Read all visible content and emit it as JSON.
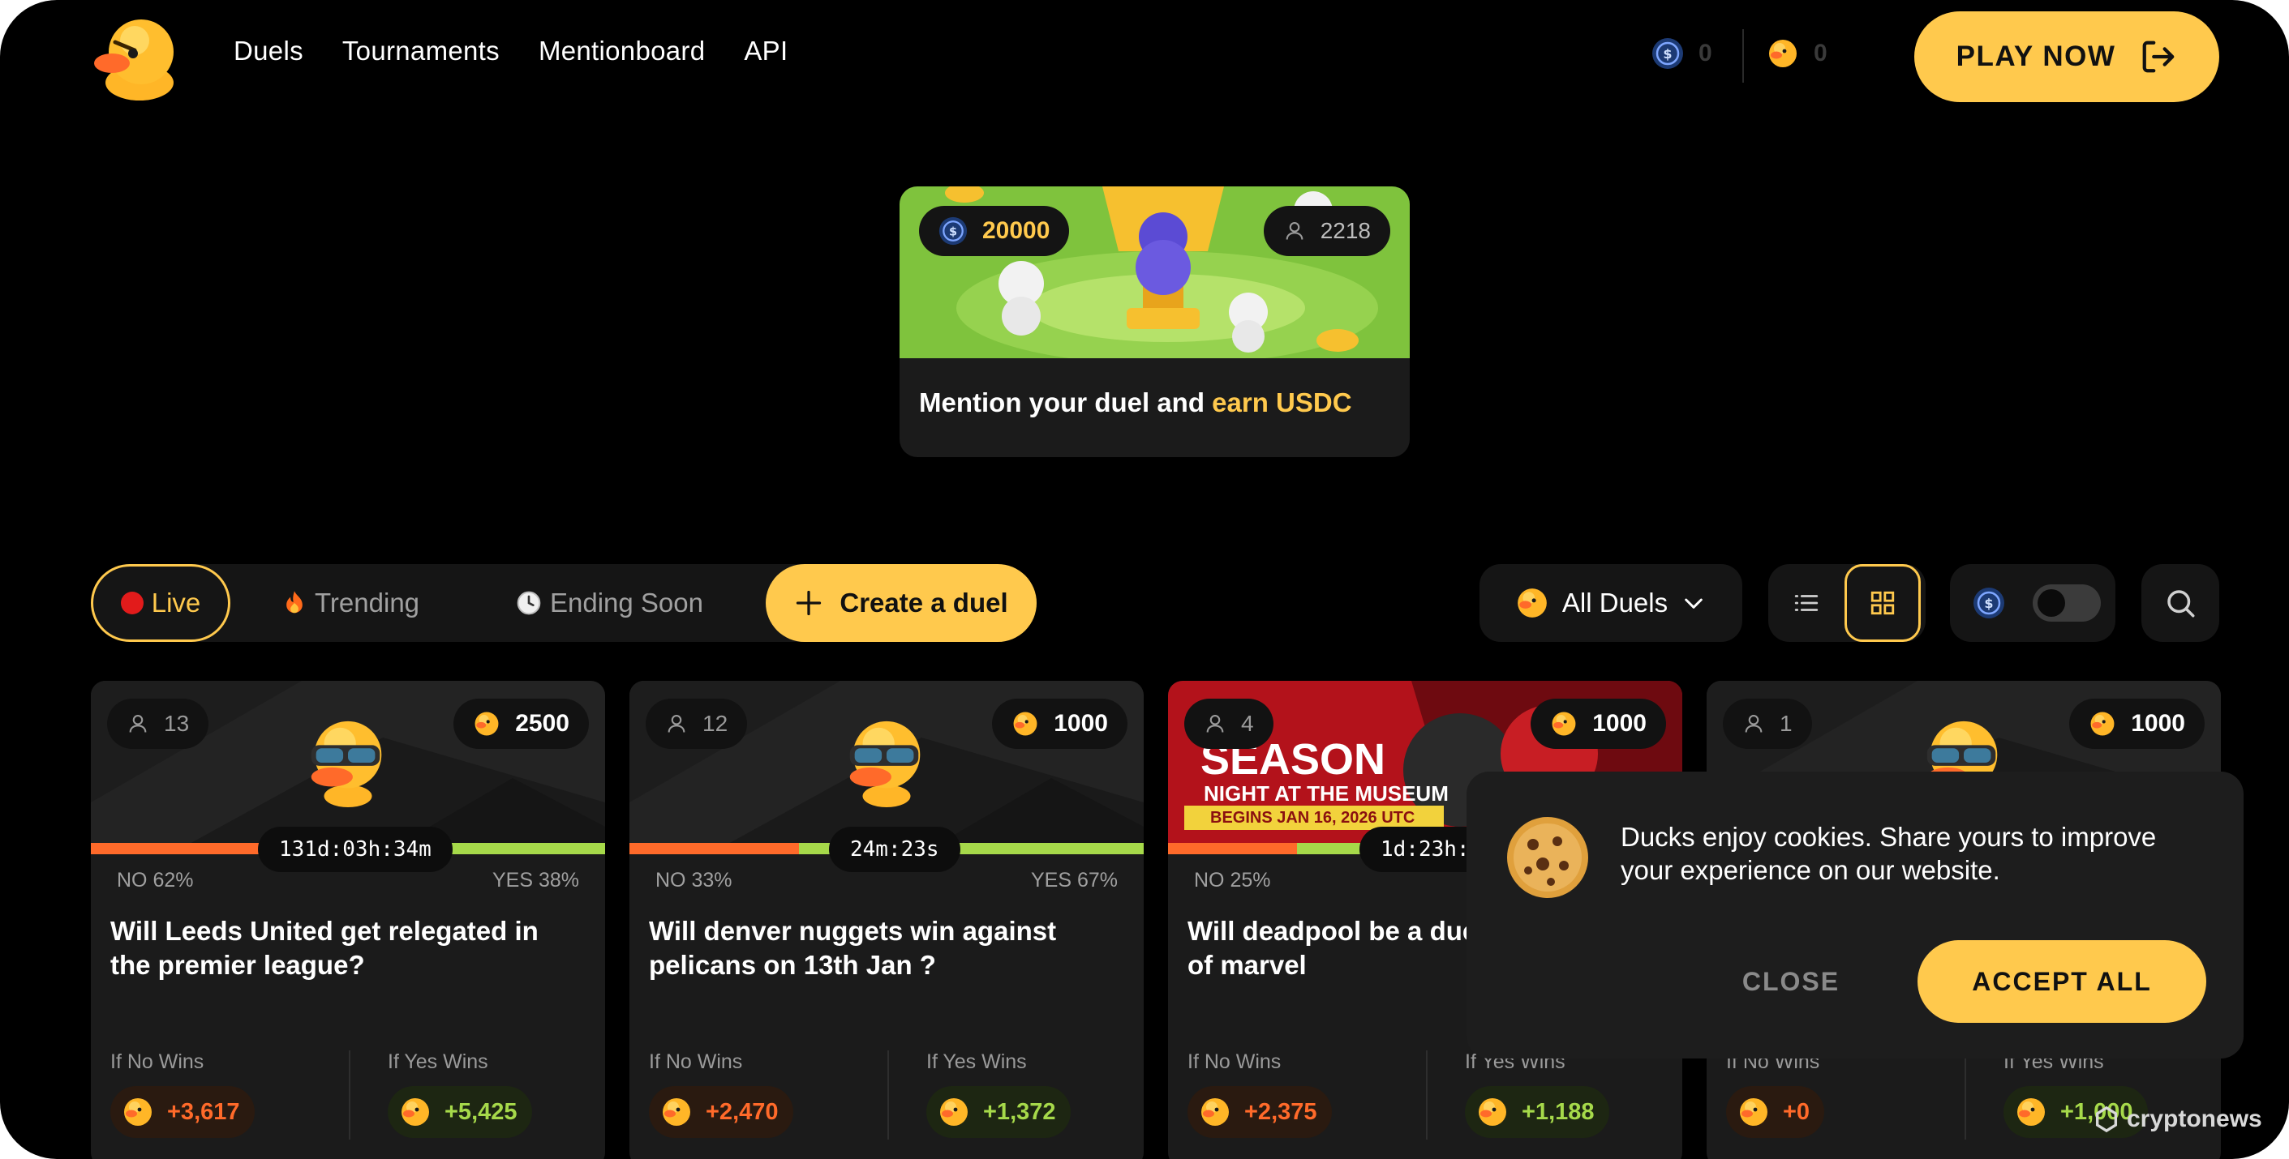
{
  "header": {
    "nav": [
      "Duels",
      "Tournaments",
      "Mentionboard",
      "API"
    ],
    "usdc_balance": "0",
    "duck_balance": "0",
    "play_label": "PLAY NOW",
    "colors": {
      "accent": "#ffc94d",
      "no": "#ff6a2a",
      "yes": "#a6d94a"
    }
  },
  "promo": {
    "prize": "20000",
    "participants": "2218",
    "text_prefix": "Mention your duel and ",
    "text_highlight": "earn USDC"
  },
  "filters": {
    "live": "Live",
    "trending": "Trending",
    "ending_soon": "Ending Soon",
    "create": "Create a duel",
    "all_duels": "All Duels"
  },
  "cards": [
    {
      "players": "13",
      "pool": "2500",
      "timer": "131d:03h:34m",
      "no_pct": "NO 62%",
      "yes_pct": "YES 38%",
      "no_share": 0.62,
      "question": "Will Leeds United get relegated in the premier league?",
      "no_label": "If No Wins",
      "yes_label": "If Yes Wins",
      "no_payout": "+3,617",
      "yes_payout": "+5,425",
      "image": "duck"
    },
    {
      "players": "12",
      "pool": "1000",
      "timer": "24m:23s",
      "no_pct": "NO 33%",
      "yes_pct": "YES 67%",
      "no_share": 0.33,
      "question": "Will denver nuggets win against pelicans on 13th Jan ?",
      "no_label": "If No Wins",
      "yes_label": "If Yes Wins",
      "no_payout": "+2,470",
      "yes_payout": "+1,372",
      "image": "duck"
    },
    {
      "players": "4",
      "pool": "1000",
      "timer": "1d:23h:0",
      "no_pct": "NO 25%",
      "yes_pct": "",
      "no_share": 0.25,
      "question": "Will deadpool be a due next update of marvel",
      "no_label": "If No Wins",
      "yes_label": "If Yes Wins",
      "no_payout": "+2,375",
      "yes_payout": "+1,188",
      "image": "rivals",
      "banner_lines": [
        "SEASON",
        "NIGHT AT THE MUSEUM",
        "BEGINS JAN 16, 2026 UTC"
      ]
    },
    {
      "players": "1",
      "pool": "1000",
      "timer": "",
      "no_pct": "",
      "yes_pct": "",
      "no_share": 0.0,
      "question": "",
      "no_label": "If No Wins",
      "yes_label": "If Yes Wins",
      "no_payout": "+0",
      "yes_payout": "+1,000",
      "image": "duck"
    }
  ],
  "cookie": {
    "text": "Ducks enjoy cookies. Share yours to improve your experience on our website.",
    "close": "CLOSE",
    "accept": "ACCEPT ALL"
  },
  "watermark": "cryptonews"
}
